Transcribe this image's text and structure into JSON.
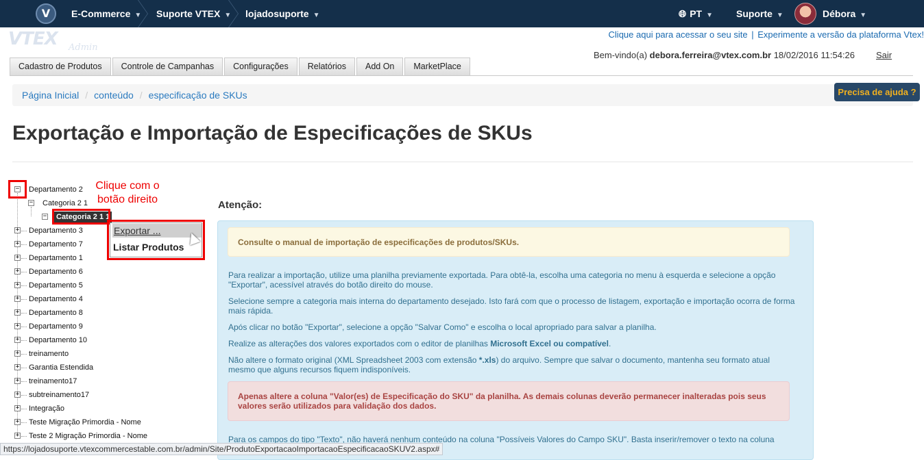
{
  "topbar": {
    "logo_letter": "V",
    "crumbs": [
      "E-Commerce",
      "Suporte VTEX",
      "lojadosuporte"
    ],
    "language": "PT",
    "support": "Suporte",
    "user": "Débora"
  },
  "header": {
    "logo_text": "VTEX",
    "logo_sub": "Admin",
    "link_site": "Clique aqui para acessar o seu site",
    "link_platform": "Experimente a versão da plataforma Vtex!",
    "welcome_prefix": "Bem-vindo(a)",
    "welcome_email": "debora.ferreira@vtex.com.br",
    "welcome_datetime": "18/02/2016 11:54:26",
    "logout": "Sair"
  },
  "tabs": [
    "Cadastro de Produtos",
    "Controle de Campanhas",
    "Configurações",
    "Relatórios",
    "Add On",
    "MarketPlace"
  ],
  "breadcrumb": [
    "Página Inicial",
    "conteúdo",
    "especificação de SKUs"
  ],
  "help_button": "Precisa de ajuda ?",
  "page_title": "Exportação e Importação de Especificações de SKUs",
  "tree": {
    "root": "Departamento 2",
    "child": "Categoria 2 1",
    "selected": "Categoria 2 1 1",
    "items": [
      "Departamento 3",
      "Departamento 7",
      "Departamento 1",
      "Departamento 6",
      "Departamento 5",
      "Departamento 4",
      "Departamento 8",
      "Departamento 9",
      "Departamento 10",
      "treinamento",
      "Garantia Estendida",
      "treinamento17",
      "subtreinamento17",
      "Integração",
      "Teste Migração Primordia - Nome",
      "Teste 2 Migração Primordia - Nome"
    ]
  },
  "annotation": "Clique com o botão direito",
  "context_menu": {
    "export": "Exportar ...",
    "list": "Listar Produtos"
  },
  "content": {
    "attention": "Atenção:",
    "warning": "Consulte o manual de importação de especificações de produtos/SKUs.",
    "p1": "Para realizar a importação, utilize uma planilha previamente exportada. Para obtê-la, escolha uma categoria no menu à esquerda e selecione a opção \"Exportar\", acessível através do botão direito do mouse.",
    "p2": "Selecione sempre a categoria mais interna do departamento desejado. Isto fará com que o processo de listagem, exportação e importação ocorra de forma mais rápida.",
    "p3": "Após clicar no botão \"Exportar\", selecione a opção \"Salvar Como\" e escolha o local apropriado para salvar a planilha.",
    "p4_prefix": "Realize as alterações dos valores exportados com o editor de planilhas ",
    "p4_bold": "Microsoft Excel ou compatível",
    "p4_suffix": ".",
    "p5_prefix": "Não altere o formato original (XML Spreadsheet 2003 com extensão ",
    "p5_bold": "*.xls",
    "p5_suffix": ") do arquivo. Sempre que salvar o documento, mantenha seu formato atual mesmo que alguns recursos fiquem indisponíveis.",
    "danger": "Apenas altere a coluna \"Valor(es) de Especificação do SKU\" da planilha. As demais colunas deverão permanecer inalteradas pois seus valores serão utilizados para validação dos dados.",
    "p6": "Para os campos do tipo \"Texto\", não haverá nenhum conteúdo na coluna \"Possíveis Valores do Campo SKU\". Basta inserir/remover o texto na coluna"
  },
  "status_url": "https://lojadosuporte.vtexcommercestable.com.br/admin/Site/ProdutoExportacaoImportacaoEspecificacaoSKUV2.aspx#"
}
